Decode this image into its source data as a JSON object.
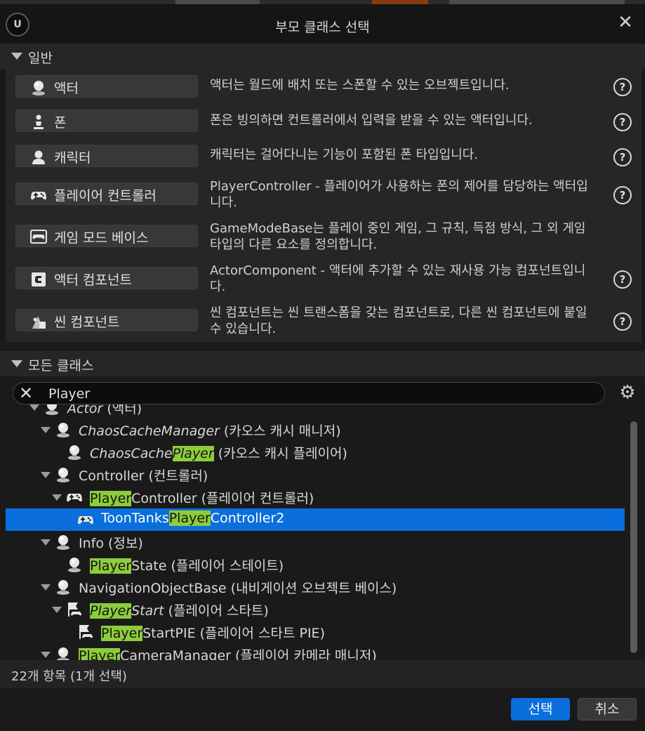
{
  "title": "부모 클래스 선택",
  "common_section": {
    "label": "일반",
    "items": [
      {
        "label": "액터",
        "icon": "actor-icon",
        "desc": "액터는 월드에 배치 또는 스폰할 수 있는 오브젝트입니다.",
        "help": true
      },
      {
        "label": "폰",
        "icon": "pawn-icon",
        "desc": "폰은 빙의하면 컨트롤러에서 입력을 받을 수 있는 액터입니다.",
        "help": true
      },
      {
        "label": "캐릭터",
        "icon": "character-icon",
        "desc": "캐릭터는 걸어다니는 기능이 포함된 폰 타입입니다.",
        "help": true
      },
      {
        "label": "플레이어 컨트롤러",
        "icon": "gamepad-icon",
        "desc": "PlayerController - 플레이어가 사용하는 폰의 제어를 담당하는 액터입니다.",
        "help": true
      },
      {
        "label": "게임 모드 베이스",
        "icon": "gamemode-icon",
        "desc": "GameModeBase는 플레이 중인 게임, 그 규칙, 득점 방식, 그 외 게임 타입의 다른 요소를 정의합니다.",
        "help": false
      },
      {
        "label": "액터 컴포넌트",
        "icon": "actor-component-icon",
        "desc": "ActorComponent - 액터에 추가할 수 있는 재사용 가능 컴포넌트입니다.",
        "help": true
      },
      {
        "label": "씬 컴포넌트",
        "icon": "scene-component-icon",
        "desc": "씬 컴포넌트는 씬 트랜스폼을 갖는 컴포넌트로, 다른 씬 컴포넌트에 붙일 수 있습니다.",
        "help": true
      }
    ]
  },
  "all_classes": {
    "label": "모든 클래스",
    "search_value": "Player",
    "tree": [
      {
        "pre": "Actor",
        "hl": "",
        "post": "",
        "suffix": " (액터)",
        "indent": 0,
        "icon": "actor-icon",
        "expanded": true,
        "italic": true,
        "selected": false
      },
      {
        "pre": "ChaosCacheManager",
        "hl": "",
        "post": "",
        "suffix": " (카오스 캐시 매니저)",
        "indent": 1,
        "icon": "actor-icon",
        "expanded": true,
        "italic": true,
        "selected": false
      },
      {
        "pre": "ChaosCache",
        "hl": "Player",
        "post": "",
        "suffix": " (카오스 캐시 플레이어)",
        "indent": 2,
        "icon": "actor-icon",
        "expanded": false,
        "italic": true,
        "selected": false
      },
      {
        "pre": "Controller",
        "hl": "",
        "post": "",
        "suffix": " (컨트롤러)",
        "indent": 1,
        "icon": "actor-icon",
        "expanded": true,
        "italic": false,
        "selected": false
      },
      {
        "pre": "",
        "hl": "Player",
        "post": "Controller",
        "suffix": " (플레이어 컨트롤러)",
        "indent": 2,
        "icon": "gamepad-icon",
        "expanded": true,
        "italic": false,
        "selected": false
      },
      {
        "pre": "ToonTanks",
        "hl": "Player",
        "post": "Controller2",
        "suffix": "",
        "indent": 3,
        "icon": "gamepad-icon",
        "expanded": false,
        "italic": false,
        "selected": true
      },
      {
        "pre": "Info",
        "hl": "",
        "post": "",
        "suffix": " (정보)",
        "indent": 1,
        "icon": "actor-icon",
        "expanded": true,
        "italic": false,
        "selected": false
      },
      {
        "pre": "",
        "hl": "Player",
        "post": "State",
        "suffix": " (플레이어 스테이트)",
        "indent": 2,
        "icon": "actor-icon",
        "expanded": false,
        "italic": false,
        "selected": false
      },
      {
        "pre": "NavigationObjectBase",
        "hl": "",
        "post": "",
        "suffix": " (내비게이션 오브젝트 베이스)",
        "indent": 1,
        "icon": "actor-icon",
        "expanded": true,
        "italic": false,
        "selected": false
      },
      {
        "pre": "",
        "hl": "Player",
        "post": "Start",
        "suffix": " (플레이어 스타트)",
        "indent": 2,
        "icon": "player-start-icon",
        "expanded": true,
        "italic": true,
        "selected": false
      },
      {
        "pre": "",
        "hl": "Player",
        "post": "StartPIE",
        "suffix": " (플레이어 스타트 PIE)",
        "indent": 3,
        "icon": "player-start-icon",
        "expanded": false,
        "italic": false,
        "selected": false
      },
      {
        "pre": "",
        "hl": "Player",
        "post": "CameraManager",
        "suffix": " (플레이어 카메라 매니저)",
        "indent": 1,
        "icon": "actor-icon",
        "expanded": true,
        "italic": false,
        "selected": false
      }
    ]
  },
  "status": "22개 항목 (1개 선택)",
  "buttons": {
    "select": "선택",
    "cancel": "취소"
  },
  "colors": {
    "selection": "#0a6fdc",
    "highlight": "#8dcc3b",
    "background": "#1a1a1a",
    "panel": "#262626"
  }
}
